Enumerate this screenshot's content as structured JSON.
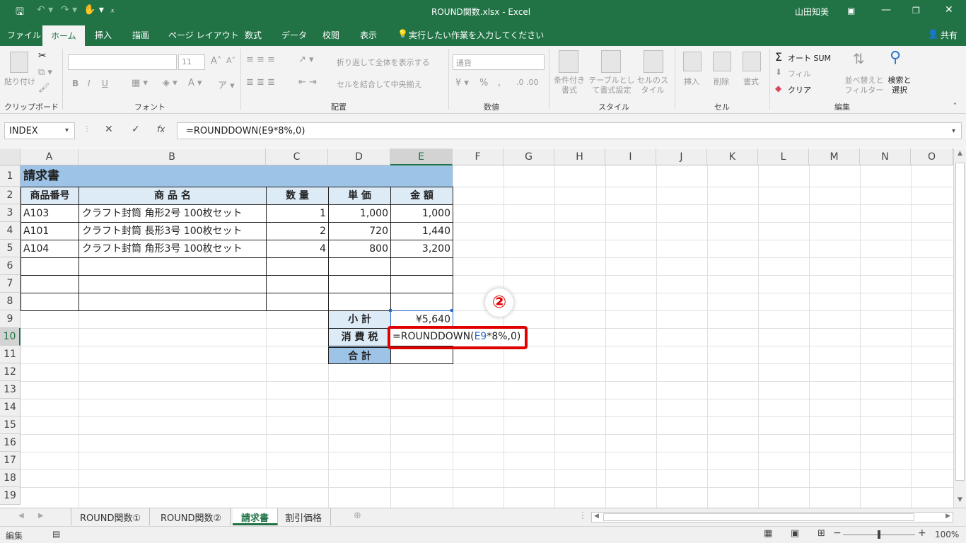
{
  "window": {
    "title": "ROUND関数.xlsx - Excel",
    "user": "山田知美",
    "share": "共有"
  },
  "ribbon_tabs": [
    "ファイル",
    "ホーム",
    "挿入",
    "描画",
    "ページ レイアウト",
    "数式",
    "データ",
    "校閲",
    "表示"
  ],
  "tell_me": "実行したい作業を入力してください",
  "ribbon": {
    "clipboard": {
      "paste": "貼り付け",
      "group": "クリップボード"
    },
    "font": {
      "size": "11",
      "bold": "B",
      "italic": "I",
      "underline": "U",
      "group": "フォント"
    },
    "alignment": {
      "wrap": "折り返して全体を表示する",
      "merge": "セルを結合して中央揃え",
      "group": "配置"
    },
    "number": {
      "format": "通貨",
      "percent": "%",
      "group": "数値"
    },
    "styles": {
      "conditional": "条件付き書式",
      "table": "テーブルとして書式設定",
      "cell": "セルのスタイル",
      "group": "スタイル"
    },
    "cells": {
      "insert": "挿入",
      "delete": "削除",
      "format": "書式",
      "group": "セル"
    },
    "editing": {
      "autosum": "オート SUM",
      "fill": "フィル",
      "clear": "クリア",
      "sort": "並べ替えとフィルター",
      "find": "検索と選択",
      "group": "編集"
    }
  },
  "formula_bar": {
    "name_box": "INDEX",
    "formula": "=ROUNDDOWN(E9*8%,0)",
    "cancel": "✕",
    "enter": "✓",
    "fx": "fx"
  },
  "columns": [
    "A",
    "B",
    "C",
    "D",
    "E",
    "F",
    "G",
    "H",
    "I",
    "J",
    "K",
    "L",
    "M",
    "N",
    "O"
  ],
  "rows": [
    "1",
    "2",
    "3",
    "4",
    "5",
    "6",
    "7",
    "8",
    "9",
    "10",
    "11",
    "12",
    "13",
    "14",
    "15",
    "16",
    "17",
    "18",
    "19"
  ],
  "sheet": {
    "title": "請求書",
    "headers": [
      "商品番号",
      "商 品 名",
      "数 量",
      "単 価",
      "金 額"
    ],
    "items": [
      {
        "code": "A103",
        "name": "クラフト封筒 角形2号 100枚セット",
        "qty": "1",
        "price": "1,000",
        "amount": "1,000"
      },
      {
        "code": "A101",
        "name": "クラフト封筒 長形3号 100枚セット",
        "qty": "2",
        "price": "720",
        "amount": "1,440"
      },
      {
        "code": "A104",
        "name": "クラフト封筒 角形3号 100枚セット",
        "qty": "4",
        "price": "800",
        "amount": "3,200"
      }
    ],
    "subtotal_label": "小 計",
    "subtotal_value": "¥5,640",
    "tax_label": "消 費 税",
    "tax_formula_prefix": "=ROUNDDOWN(",
    "tax_formula_ref": "E9",
    "tax_formula_suffix": "*8%,0)",
    "total_label": "合 計",
    "callout": "②"
  },
  "sheet_tabs": [
    "ROUND関数①",
    "ROUND関数②",
    "請求書",
    "割引価格"
  ],
  "status": {
    "mode": "編集",
    "zoom": "100%"
  },
  "colors": {
    "excel_green": "#217346",
    "header_fill": "#ddebf7",
    "title_fill": "#9dc3e6",
    "callout_red": "#e00000"
  }
}
